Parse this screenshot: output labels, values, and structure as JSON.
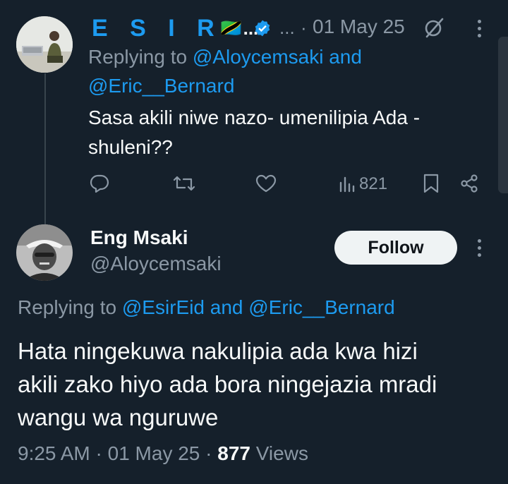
{
  "reply_tweet": {
    "display_name": "E S I R",
    "flag": "🇹🇿",
    "name_truncation": "...",
    "handle_truncation": "...",
    "separator": "·",
    "date": "01 May 25",
    "replying_prefix": "Replying to",
    "replying_users": "@Aloycemsaki and @Eric__Bernard",
    "text_line1": "Sasa akili niwe nazo- umenilipia Ada -",
    "text_line2": "shuleni??",
    "views": "821"
  },
  "main_tweet": {
    "display_name": "Eng Msaki",
    "handle": "@Aloycemsaki",
    "follow_label": "Follow",
    "replying_prefix": "Replying to",
    "replying_user1": "@EsirEid",
    "replying_and": "and",
    "replying_user2": "@Eric__Bernard",
    "text_line1": "Hata ningekuwa nakulipia ada kwa hizi",
    "text_line2": "akili zako hiyo ada bora ningejazia mradi",
    "text_line3": "wangu wa nguruwe",
    "time": "9:25 AM",
    "separator": "·",
    "date": "01 May 25",
    "views_count": "877",
    "views_label": "Views"
  },
  "colors": {
    "background": "#15202b",
    "accent": "#1d9bf0",
    "text": "#f7f9f9",
    "muted": "#8b98a5"
  },
  "icons": [
    "verified-badge-icon",
    "grok-slash-icon",
    "more-icon",
    "reply-icon",
    "retweet-icon",
    "like-icon",
    "views-icon",
    "bookmark-icon",
    "share-icon"
  ]
}
